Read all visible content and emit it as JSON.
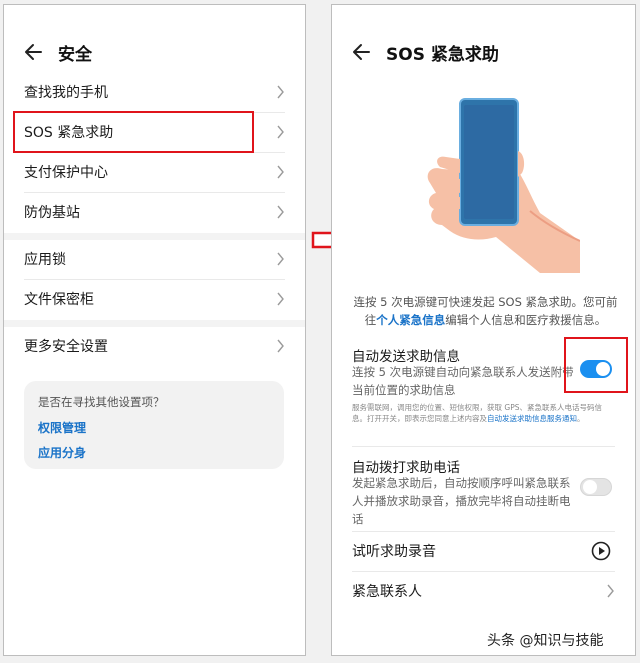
{
  "left": {
    "header_title": "安全",
    "group1": [
      "查找我的手机",
      "SOS 紧急求助",
      "支付保护中心",
      "防伪基站"
    ],
    "group2": [
      "应用锁",
      "文件保密柜"
    ],
    "group3": [
      "更多安全设置"
    ],
    "suggest": {
      "question": "是否在寻找其他设置项？",
      "links": [
        "权限管理",
        "应用分身"
      ]
    }
  },
  "right": {
    "header_title": "SOS 紧急求助",
    "desc_pre": "连按 5 次电源键可快速发起 SOS 紧急求助。您可前往",
    "desc_link": "个人紧急信息",
    "desc_post": "编辑个人信息和医疗救援信息。",
    "auto_send": {
      "title": "自动发送求助信息",
      "desc": "连按 5 次电源键自动向紧急联系人发送附带当前位置的求助信息",
      "fine_pre": "服务需联网，调用您的位置、短信权限，获取 GPS、紧急联系人电话号码信息。打开开关，即表示您同意上述内容及",
      "fine_link": "自动发送求助信息服务通知",
      "fine_post": "。",
      "enabled": true
    },
    "auto_call": {
      "title": "自动拨打求助电话",
      "desc": "发起紧急求助后，自动按顺序呼叫紧急联系人并播放求助录音，播放完毕将自动挂断电话",
      "enabled": false
    },
    "listen_label": "试听求助录音",
    "contacts_label": "紧急联系人"
  },
  "watermark": "头条 @知识与技能",
  "colors": {
    "accent": "#1a8ff0",
    "link": "#1a73c8",
    "highlight": "#e0141b"
  }
}
